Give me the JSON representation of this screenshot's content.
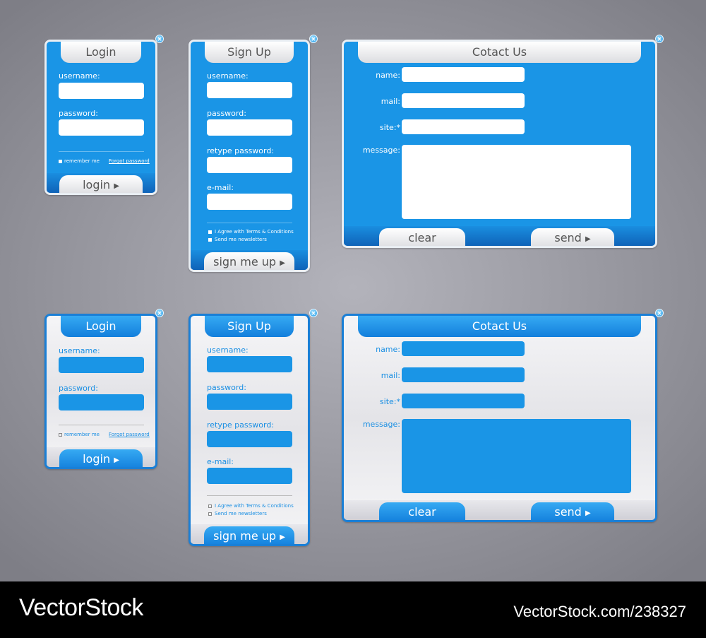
{
  "login": {
    "title": "Login",
    "username_label": "username:",
    "password_label": "password:",
    "remember": "remember me",
    "forgot": "Forgot password",
    "button": "login"
  },
  "signup": {
    "title": "Sign Up",
    "username_label": "username:",
    "password_label": "password:",
    "retype_label": "retype password:",
    "email_label": "e-mail:",
    "agree": "I Agree with Terms & Conditions",
    "newsletter": "Send me newsletters",
    "button": "sign me up"
  },
  "contact": {
    "title": "Cotact Us",
    "name_label": "name:",
    "mail_label": "mail:",
    "site_label": "site:*",
    "message_label": "message:",
    "clear": "clear",
    "send": "send"
  },
  "icons": {
    "close": "close-icon",
    "arrow": "play-triangle-icon"
  },
  "colors": {
    "accent": "#1a95e6",
    "panel_light": "#f0f0f2",
    "footer": "#000000"
  },
  "footer": {
    "brand": "VectorStock",
    "url": "VectorStock.com/238327"
  }
}
